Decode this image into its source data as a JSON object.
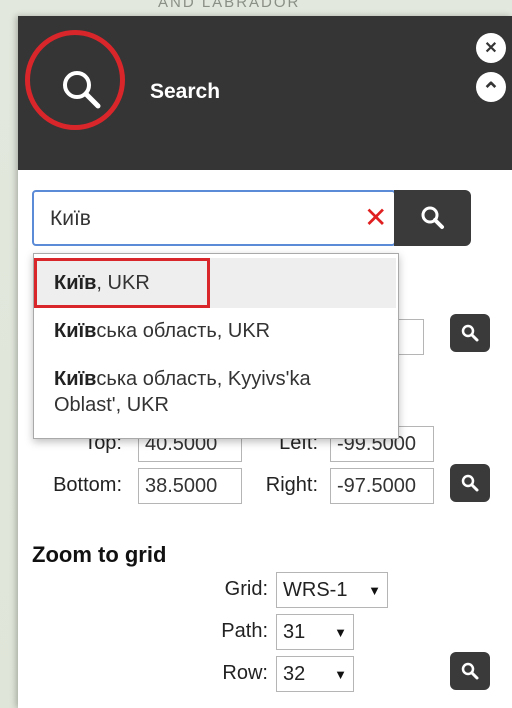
{
  "map": {
    "label": "AND LABRADOR"
  },
  "header": {
    "title": "Search",
    "close_glyph": "✕",
    "collapse_glyph": "⌃"
  },
  "search": {
    "value": "Київ",
    "clear_glyph": "✕"
  },
  "suggestions": [
    {
      "match": "Київ",
      "rest": ", UKR"
    },
    {
      "match": "Київ",
      "rest": "ська область, UKR"
    },
    {
      "match": "Київ",
      "rest": "ська область, Kyyivs'ka Oblast', UKR"
    }
  ],
  "bbox": {
    "top_label": "Top:",
    "top_value": "40.5000",
    "left_label": "Left:",
    "left_value": "-99.5000",
    "bottom_label": "Bottom:",
    "bottom_value": "38.5000",
    "right_label": "Right:",
    "right_value": "-97.5000"
  },
  "zoom_grid": {
    "title": "Zoom to grid",
    "grid_label": "Grid:",
    "grid_value": "WRS-1",
    "path_label": "Path:",
    "path_value": "31",
    "row_label": "Row:",
    "row_value": "32"
  }
}
